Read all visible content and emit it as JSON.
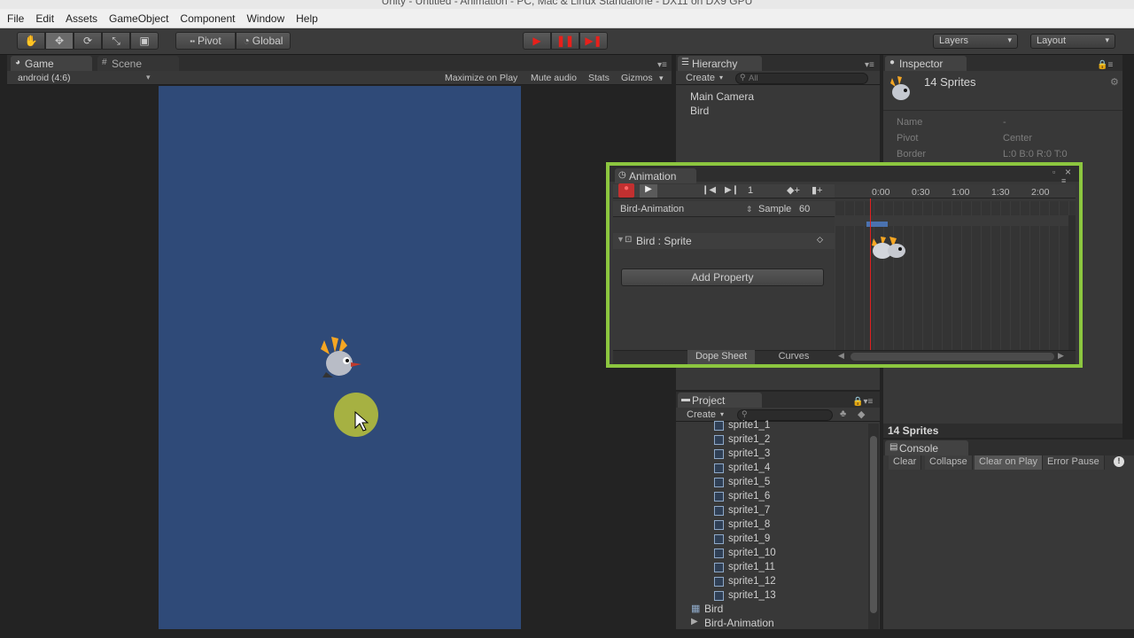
{
  "window": {
    "title": "Unity - Untitled - Animation - PC, Mac & Linux Standalone - DX11 on DX9 GPU"
  },
  "menu": [
    "File",
    "Edit",
    "Assets",
    "GameObject",
    "Component",
    "Window",
    "Help"
  ],
  "toolbar": {
    "pivot_label": "Pivot",
    "global_label": "Global",
    "layers_label": "Layers",
    "layout_label": "Layout",
    "play_color": "#e8201b"
  },
  "game": {
    "tab_game": "Game",
    "tab_scene": "Scene",
    "aspect": "android (4:6)",
    "maximize": "Maximize on Play",
    "mute": "Mute audio",
    "stats": "Stats",
    "gizmos": "Gizmos",
    "bg_color": "#2f4a78"
  },
  "hierarchy": {
    "tab": "Hierarchy",
    "create": "Create",
    "search_placeholder": "All",
    "items": [
      "Main Camera",
      "Bird"
    ]
  },
  "inspector": {
    "tab": "Inspector",
    "title": "14 Sprites",
    "fields": [
      {
        "label": "Name",
        "value": "-"
      },
      {
        "label": "Pivot",
        "value": "Center"
      },
      {
        "label": "Border",
        "value": "L:0 B:0 R:0 T:0"
      }
    ],
    "preview_title": "14 Sprites"
  },
  "animation": {
    "tab": "Animation",
    "frame": "1",
    "clip": "Bird-Animation",
    "sample_label": "Sample",
    "sample_value": "60",
    "property": "Bird : Sprite",
    "add_property": "Add Property",
    "timeline_labels": [
      "0:00",
      "0:30",
      "1:00",
      "1:30",
      "2:00"
    ],
    "dope_sheet": "Dope Sheet",
    "curves": "Curves",
    "highlight_color": "#8cc63f"
  },
  "project": {
    "tab": "Project",
    "create": "Create",
    "sprites": [
      "sprite1_1",
      "sprite1_2",
      "sprite1_3",
      "sprite1_4",
      "sprite1_5",
      "sprite1_6",
      "sprite1_7",
      "sprite1_8",
      "sprite1_9",
      "sprite1_10",
      "sprite1_11",
      "sprite1_12",
      "sprite1_13"
    ],
    "assets": [
      "Bird",
      "Bird-Animation"
    ]
  },
  "console": {
    "tab": "Console",
    "buttons": [
      "Clear",
      "Collapse",
      "Clear on Play",
      "Error Pause"
    ]
  }
}
